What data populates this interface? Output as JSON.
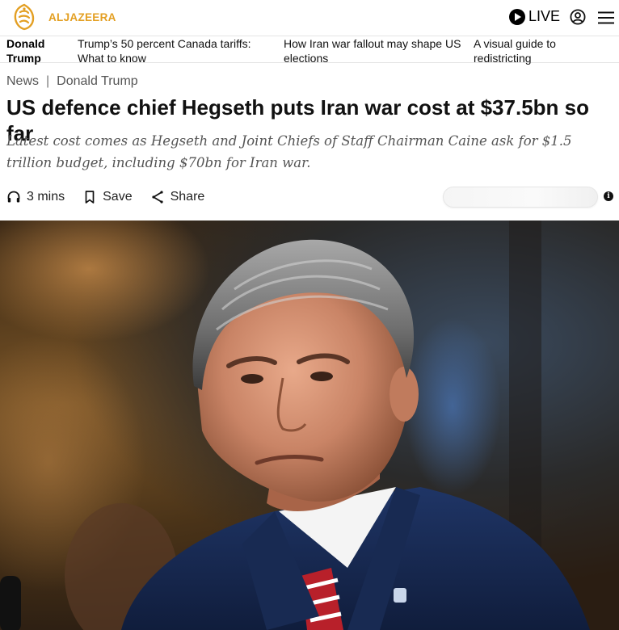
{
  "header": {
    "logo_text": "ALJAZEERA",
    "live_label": "LIVE",
    "brand_color": "#e39f22"
  },
  "trending": {
    "heading": "Donald Trump",
    "links": [
      "Trump’s 50 percent Canada tariffs: What to know",
      "How Iran war fallout may shape US elections",
      "A visual guide to redistricting"
    ]
  },
  "article": {
    "breadcrumb": [
      "News",
      "Donald Trump"
    ],
    "breadcrumb_separator": "|",
    "headline": "US defence chief Hegseth puts Iran war cost at $37.5bn so far",
    "standfirst": "Latest cost comes as Hegseth and Joint Chiefs of Staff Chairman Caine ask for $1.5 trillion budget, including $70bn for Iran war.",
    "actions": {
      "listen": "3 mins",
      "save": "Save",
      "share": "Share"
    }
  },
  "icons": {
    "live": "play-circle-icon",
    "user": "user-icon",
    "menu": "menu-icon",
    "listen": "headphones-icon",
    "save": "bookmark-icon",
    "share": "share-icon",
    "info": "info-icon"
  }
}
